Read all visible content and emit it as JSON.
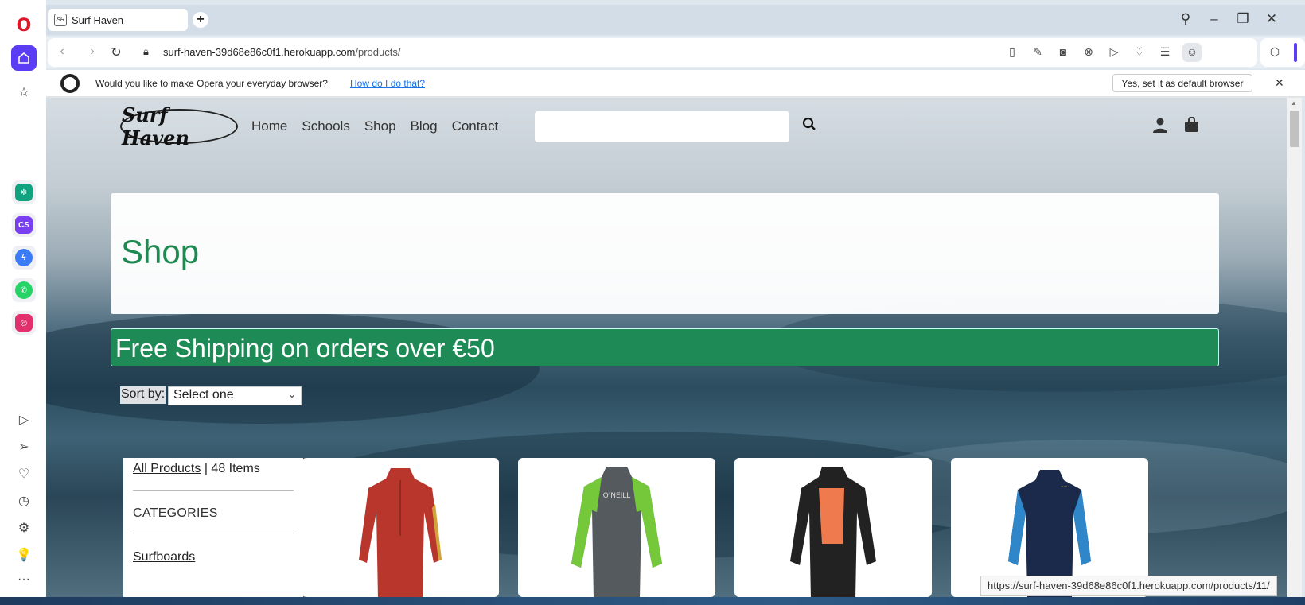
{
  "browser": {
    "tab_title": "Surf Haven",
    "url_domain": "surf-haven-39d68e86c0f1.herokuapp.com",
    "url_path": "/products/",
    "infobar_text": "Would you like to make Opera your everyday browser?",
    "infobar_link": "How do I do that?",
    "infobar_button": "Yes, set it as default browser",
    "status_url": "https://surf-haven-39d68e86c0f1.herokuapp.com/products/11/"
  },
  "site": {
    "logo_text": "Surf Haven",
    "nav": [
      "Home",
      "Schools",
      "Shop",
      "Blog",
      "Contact"
    ],
    "search_placeholder": ""
  },
  "hero": {
    "title": "Shop"
  },
  "banner": {
    "text": "Free Shipping on orders over €50"
  },
  "sort": {
    "label": "Sort by:",
    "selected": "Select one"
  },
  "filters": {
    "all_products_link": "All Products",
    "item_count": " | 48 Items",
    "categories_heading": "CATEGORIES",
    "category_link": "Surfboards"
  },
  "products": [
    {
      "image": "red-wetsuit",
      "colors": [
        "#b8362b",
        "#d3a33a"
      ]
    },
    {
      "image": "green-grey-wetsuit",
      "colors": [
        "#74c83a",
        "#555a5e"
      ]
    },
    {
      "image": "black-orange-wetsuit",
      "colors": [
        "#222222",
        "#ef7a4e"
      ]
    },
    {
      "image": "navy-blue-wetsuit",
      "colors": [
        "#1b2a4a",
        "#2f86c9"
      ]
    }
  ],
  "icons": {
    "sidebar": [
      "opera-logo-icon",
      "home-icon",
      "star-icon",
      "chatgpt-icon",
      "crypto-icon",
      "messenger-icon",
      "whatsapp-icon",
      "instagram-icon",
      "player-icon",
      "send-icon",
      "heart-icon",
      "history-icon",
      "settings-icon",
      "bulb-icon",
      "more-icon"
    ]
  },
  "colors": {
    "brand_green": "#1e8a55",
    "opera_accent": "#5b3df5"
  }
}
